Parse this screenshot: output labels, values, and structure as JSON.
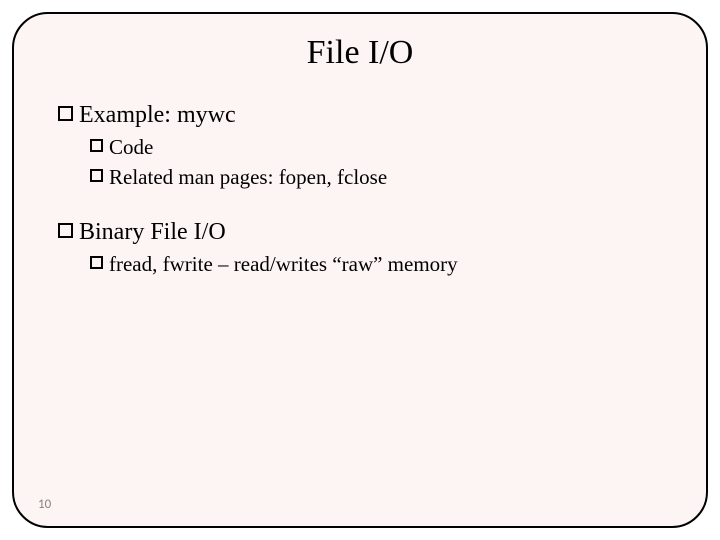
{
  "slide": {
    "title": "File I/O",
    "page_number": "10",
    "group1": {
      "heading": "Example: mywc",
      "items": {
        "a": "Code",
        "b": "Related man pages: fopen, fclose"
      }
    },
    "group2": {
      "heading": "Binary File I/O",
      "items": {
        "a": "fread, fwrite – read/writes “raw” memory"
      }
    }
  }
}
